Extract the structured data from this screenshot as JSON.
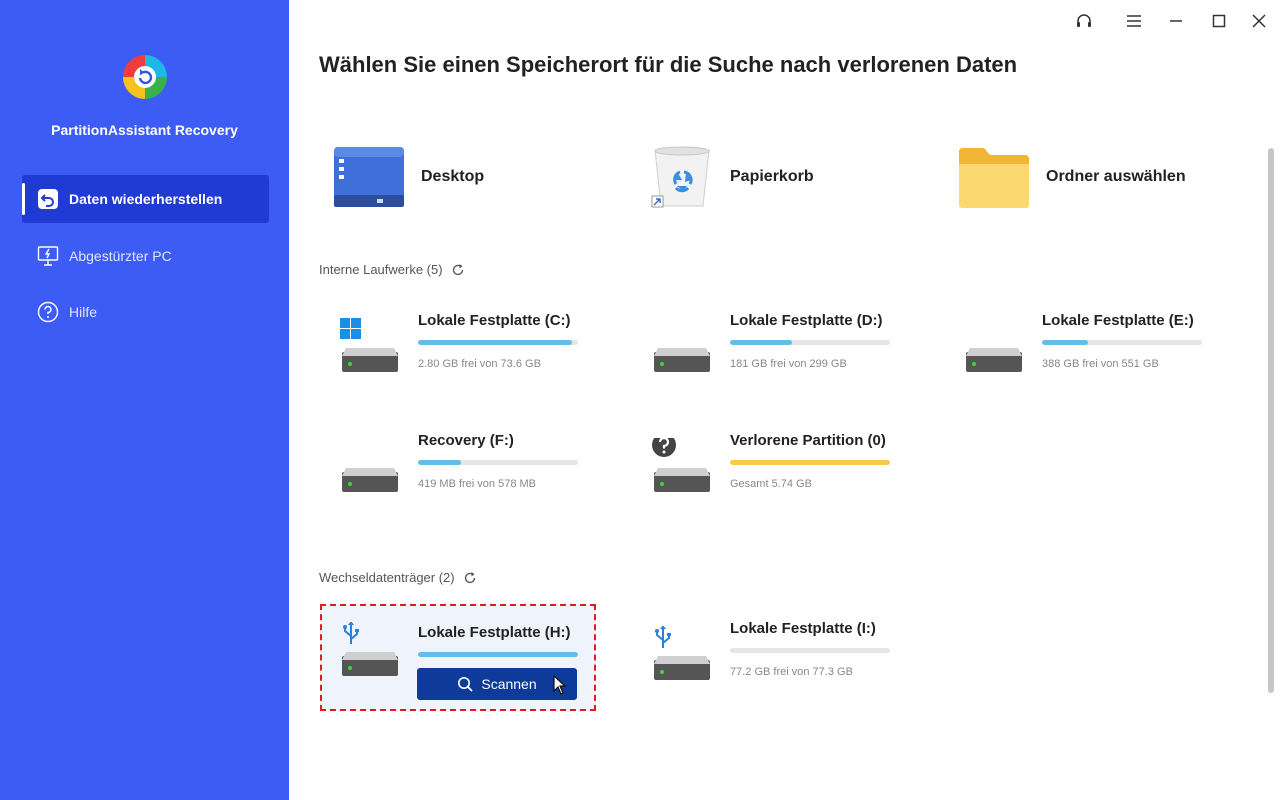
{
  "app": {
    "title": "PartitionAssistant Recovery"
  },
  "sidebar": {
    "items": [
      {
        "label": "Daten wiederherstellen",
        "icon": "restore-icon",
        "active": true
      },
      {
        "label": "Abgestürzter PC",
        "icon": "crashed-pc-icon",
        "active": false
      },
      {
        "label": "Hilfe",
        "icon": "help-icon",
        "active": false
      }
    ]
  },
  "window_controls": [
    "headset-icon",
    "menu-icon",
    "minimize-icon",
    "maximize-icon",
    "close-icon"
  ],
  "main": {
    "title": "Wählen Sie einen Speicherort für die Suche nach verlorenen Daten",
    "quick_locations": [
      {
        "label": "Desktop",
        "icon": "desktop-icon"
      },
      {
        "label": "Papierkorb",
        "icon": "recycle-bin-icon"
      },
      {
        "label": "Ordner auswählen",
        "icon": "folder-icon"
      }
    ],
    "internal": {
      "label": "Interne Laufwerke (5)",
      "drives": [
        {
          "name": "Lokale Festplatte (C:)",
          "info": "2.80 GB frei von 73.6 GB",
          "used_fraction": 0.96,
          "badge": "windows-icon"
        },
        {
          "name": "Lokale Festplatte (D:)",
          "info": "181 GB frei von 299 GB",
          "used_fraction": 0.39
        },
        {
          "name": "Lokale Festplatte (E:)",
          "info": "388 GB frei von 551 GB",
          "used_fraction": 0.29
        },
        {
          "name": "Recovery (F:)",
          "info": "419 MB frei von 578 MB",
          "used_fraction": 0.27
        },
        {
          "name": "Verlorene Partition (0)",
          "info": "Gesamt 5.74 GB",
          "used_fraction": 1.0,
          "badge": "question-icon",
          "color": "#f7cb46"
        }
      ]
    },
    "removable": {
      "label": "Wechseldatenträger (2)",
      "drives": [
        {
          "name": "Lokale Festplatte (H:)",
          "used_fraction": 1.0,
          "badge": "usb-icon",
          "selected": true,
          "scan_label": "Scannen"
        },
        {
          "name": "Lokale Festplatte (I:)",
          "info": "77.2 GB frei von 77.3 GB",
          "used_fraction": 0.0,
          "badge": "usb-icon"
        }
      ]
    }
  },
  "colors": {
    "sidebar_bg": "#3d5bf5",
    "sidebar_active": "#1f3bd3",
    "bar_blue": "#63bde6",
    "bar_yellow": "#f7cb46",
    "scan_button": "#0e3a9a",
    "selection_border": "#e21b23"
  }
}
